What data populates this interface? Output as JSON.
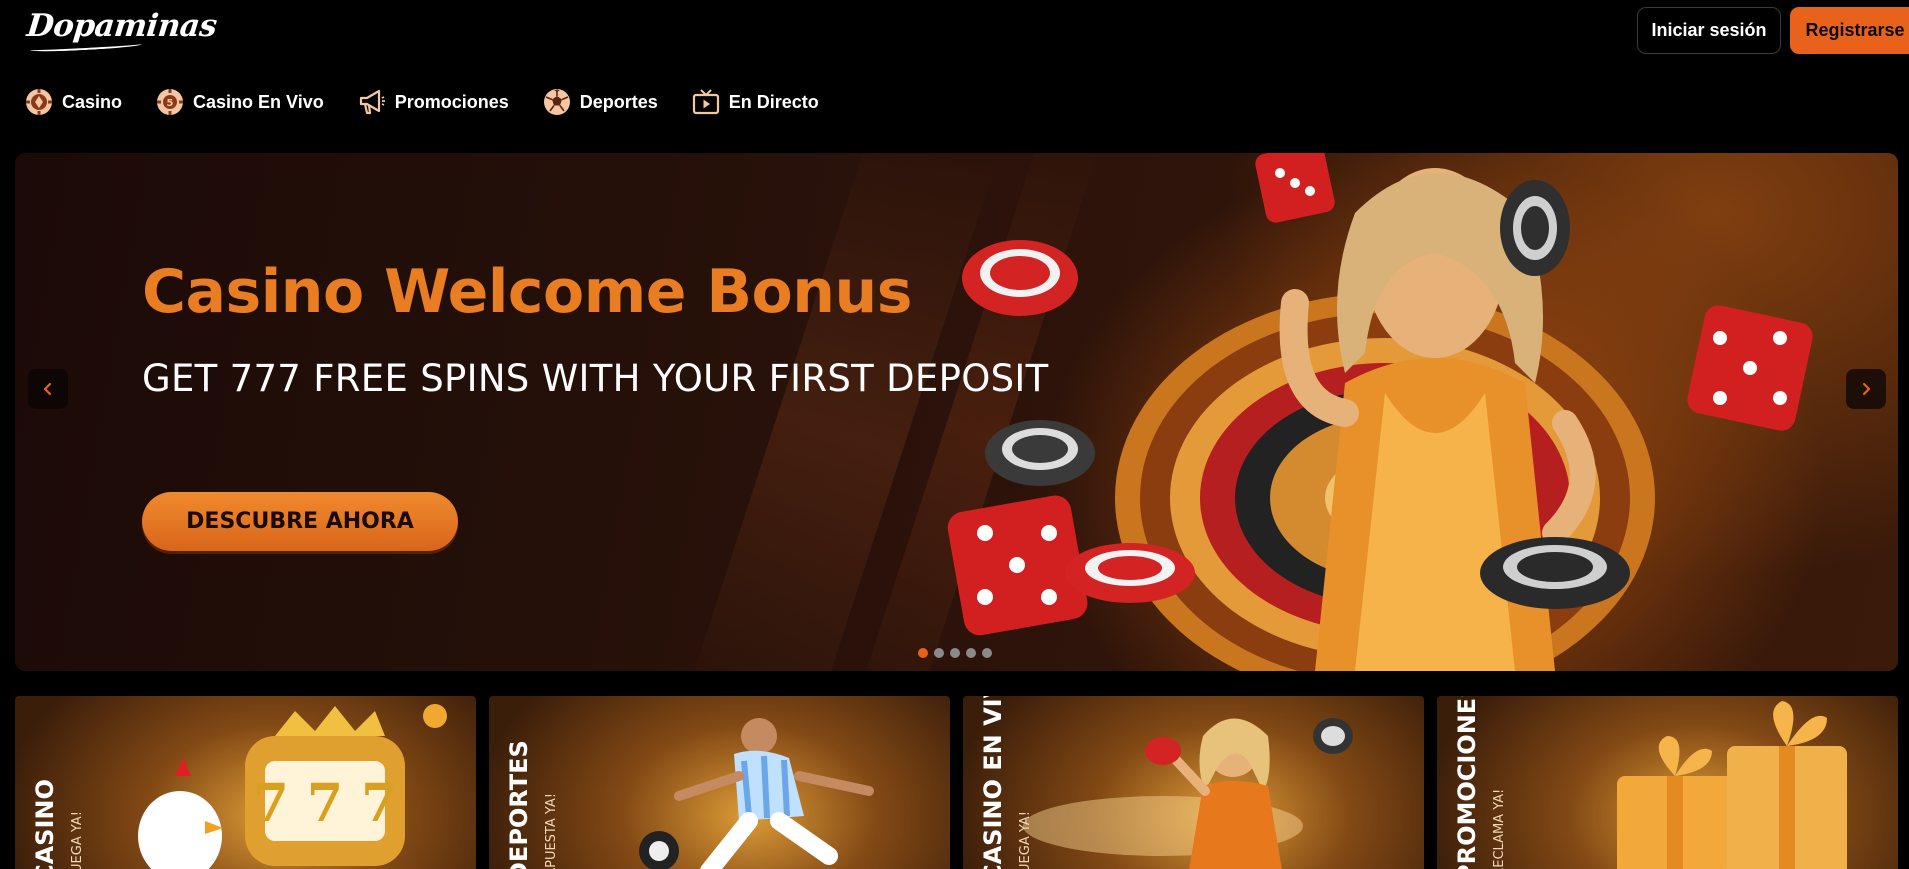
{
  "header": {
    "logo_text": "Dopaminas",
    "login_label": "Iniciar sesión",
    "register_label": "Registrarse"
  },
  "nav": {
    "items": [
      {
        "label": "Casino",
        "icon": "casino-chip-icon"
      },
      {
        "label": "Casino En Vivo",
        "icon": "live-casino-chip-icon"
      },
      {
        "label": "Promociones",
        "icon": "megaphone-icon"
      },
      {
        "label": "Deportes",
        "icon": "soccer-ball-icon"
      },
      {
        "label": "En Directo",
        "icon": "tv-play-icon"
      }
    ]
  },
  "hero": {
    "title": "Casino Welcome Bonus",
    "subtitle": "GET 777 FREE SPINS WITH YOUR FIRST DEPOSIT",
    "cta_label": "DESCUBRE AHORA",
    "slide_count": 5,
    "active_slide": 1
  },
  "cards": [
    {
      "label": "CASINO",
      "sub": "¡JUEGA YA!"
    },
    {
      "label": "DEPORTES",
      "sub": "¡APUESTA YA!"
    },
    {
      "label": "CASINO EN VIVO",
      "sub": "¡JUEGA YA!"
    },
    {
      "label": "PROMOCIONES",
      "sub": "¡RECLAMA YA!"
    }
  ],
  "colors": {
    "accent": "#e8621c",
    "title_orange": "#e87d22",
    "background": "#000000"
  }
}
